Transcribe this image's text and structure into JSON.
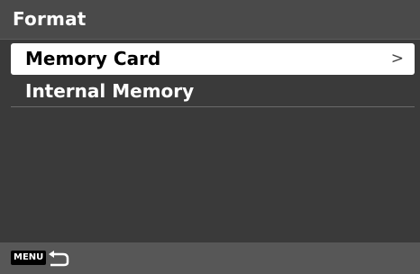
{
  "header": {
    "title": "Format"
  },
  "menu": {
    "items": [
      {
        "label": "Memory Card",
        "selected": true,
        "chevron": ">"
      },
      {
        "label": "Internal Memory",
        "selected": false
      }
    ]
  },
  "footer": {
    "menu_key_label": "MENU",
    "back_icon": "return-arrow-icon"
  },
  "colors": {
    "background": "#3a3a3a",
    "title_bar": "#4a4a4a",
    "selected_item": "#ffffff",
    "footer": "#575757"
  }
}
